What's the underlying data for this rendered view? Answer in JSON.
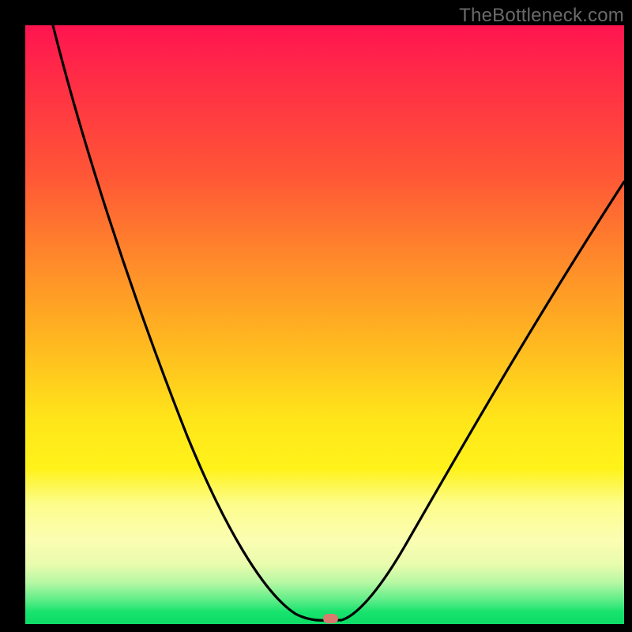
{
  "watermark": "TheBottleneck.com",
  "chart_data": {
    "type": "line",
    "title": "",
    "xlabel": "",
    "ylabel": "",
    "xlim": [
      0,
      100
    ],
    "ylim": [
      0,
      100
    ],
    "grid": false,
    "legend": false,
    "gradient_bands": [
      {
        "name": "red",
        "approx_y_pct_from_top": 0
      },
      {
        "name": "orange",
        "approx_y_pct_from_top": 40
      },
      {
        "name": "yellow",
        "approx_y_pct_from_top": 70
      },
      {
        "name": "pale-yellow",
        "approx_y_pct_from_top": 85
      },
      {
        "name": "green",
        "approx_y_pct_from_top": 97
      }
    ],
    "series": [
      {
        "name": "bottleneck-curve",
        "x": [
          0,
          5,
          10,
          15,
          20,
          25,
          30,
          35,
          40,
          45,
          48,
          50,
          52,
          55,
          60,
          65,
          70,
          75,
          80,
          85,
          90,
          95,
          100
        ],
        "y": [
          100,
          89,
          78,
          67,
          56,
          45,
          35,
          26,
          18,
          10,
          5,
          1,
          1,
          3,
          9,
          17,
          25,
          33,
          41,
          49,
          56,
          63,
          70
        ]
      }
    ],
    "marker": {
      "x": 51,
      "y": 0.5,
      "color": "#d97a6f",
      "shape": "pill"
    }
  }
}
